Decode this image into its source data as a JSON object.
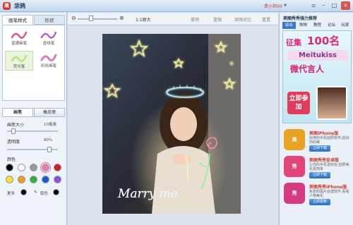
{
  "window": {
    "title": "涂鸦",
    "user": "贵小邦00",
    "controls": {
      "minimize": "–",
      "maximize": "□",
      "close": "×"
    }
  },
  "left_panel": {
    "tabs": [
      {
        "label": "画笔样式",
        "active": true
      },
      {
        "label": "形状",
        "active": false
      }
    ],
    "brushes": [
      {
        "label": "普通画笔",
        "color": "#e0557f"
      },
      {
        "label": "虚线笔",
        "color": "#b45ad6"
      },
      {
        "label": "荧光笔",
        "color": "#a8d86a",
        "selected": true
      },
      {
        "label": "织纹画笔",
        "color": "#d97bb8"
      }
    ],
    "modes": [
      {
        "label": "画笔",
        "active": true
      },
      {
        "label": "橡皮擦",
        "active": false
      }
    ],
    "brush_size": {
      "label": "画笔大小",
      "value": "10像素",
      "level": 0.1
    },
    "opacity": {
      "label": "透明度",
      "value": "80%",
      "level": 0.8
    },
    "color_label": "颜色",
    "colors": [
      "#000000",
      "#ffffff",
      "#999999",
      "#f07ab0",
      "#cc1f1f",
      "#f5e12a",
      "#f39a1f",
      "#2bb040",
      "#1f58c8",
      "#8a4fd6"
    ],
    "selected_color": "#f07ab0",
    "more_label": "更多",
    "picker_label": "取色"
  },
  "toolbar": {
    "zoom_label": "1:1原大",
    "undo": "撤销",
    "redo": "重做",
    "eraser_label": "原图对比",
    "reset": "重置"
  },
  "photo": {
    "caption": "Marry me"
  },
  "right_panel": {
    "title": "美图秀秀强力推荐",
    "tabs": [
      {
        "label": "综合",
        "active": true
      },
      {
        "label": "购物",
        "active": false
      },
      {
        "label": "教程",
        "active": false
      },
      {
        "label": "论坛",
        "active": false
      },
      {
        "label": "玩家",
        "active": false
      }
    ],
    "ad": {
      "line1": "征集",
      "line2": "100名",
      "brand": "Meitukiss",
      "line3": "微代言人",
      "cta": "立即参加"
    },
    "promos": [
      {
        "title": "美图iPhone版",
        "desc": "好用的手机拍照软件,拍出你的美",
        "button": "立即下载",
        "icon_text": "美",
        "color": "#e8a324"
      },
      {
        "title": "美图秀秀安卓版",
        "desc": "让你的手机更好玩,拍照美化更简单",
        "button": "立即下载",
        "icon_text": "秀",
        "color": "#e2457a"
      },
      {
        "title": "美图秀秀iPhone版",
        "desc": "免费的图片处理软件,看看人物美化",
        "button": "立即更新",
        "icon_text": "秀",
        "color": "#d53b80"
      }
    ]
  }
}
